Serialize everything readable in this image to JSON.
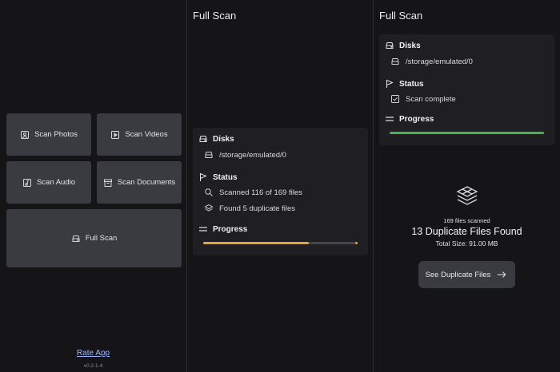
{
  "home": {
    "tiles": {
      "scan_photos": "Scan Photos",
      "scan_videos": "Scan Videos",
      "scan_audio": "Scan Audio",
      "scan_documents": "Scan Documents",
      "full_scan": "Full Scan"
    },
    "rate_app": "Rate App",
    "version": "v0.2.1-4"
  },
  "scanning": {
    "title": "Full Scan",
    "disks_label": "Disks",
    "disk_path": "/storage/emulated/0",
    "status_label": "Status",
    "status_scanned": "Scanned 116 of 169 files",
    "status_found": "Found 5 duplicate files",
    "progress_label": "Progress",
    "progress_fraction": 0.686
  },
  "complete": {
    "title": "Full Scan",
    "disks_label": "Disks",
    "disk_path": "/storage/emulated/0",
    "status_label": "Status",
    "status_text": "Scan complete",
    "progress_label": "Progress",
    "progress_fraction": 1.0,
    "files_scanned": "169 files scanned",
    "duplicates_found": "13 Duplicate Files Found",
    "total_size": "Total Size: 91.00 MB",
    "see_button": "See Duplicate Files"
  },
  "colors": {
    "accent_orange": "#e8a23a",
    "accent_green": "#4caf50",
    "track": "#45464d"
  },
  "icons": [
    "photo-icon",
    "video-icon",
    "audio-icon",
    "document-icon",
    "disk-icon",
    "flag-icon",
    "search-icon",
    "layers-icon",
    "menu-icon",
    "check-icon",
    "arrow-right-icon"
  ]
}
